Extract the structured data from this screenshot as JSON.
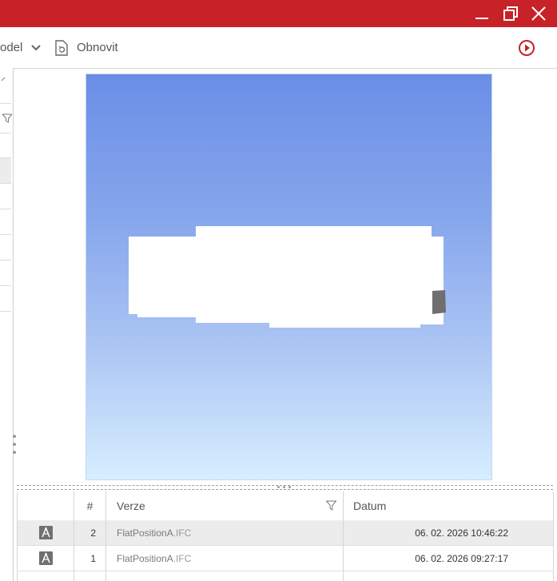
{
  "titlebar": {
    "color": "#c62228",
    "controls": [
      "minimize-icon",
      "restore-icon",
      "close-icon"
    ]
  },
  "toolbar": {
    "model_label": "odel",
    "refresh_label": "Obnovit",
    "play_icon_color": "#c62228"
  },
  "grid": {
    "columns": {
      "number": "#",
      "version": "Verze",
      "date": "Datum"
    },
    "rows": [
      {
        "number": "2",
        "file_name": "FlatPositionA",
        "file_ext": ".IFC",
        "date": "06. 02. 2026 10:46:22",
        "selected": true
      },
      {
        "number": "1",
        "file_name": "FlatPositionA",
        "file_ext": ".IFC",
        "date": "06. 02. 2026 09:27:17",
        "selected": false
      }
    ]
  }
}
